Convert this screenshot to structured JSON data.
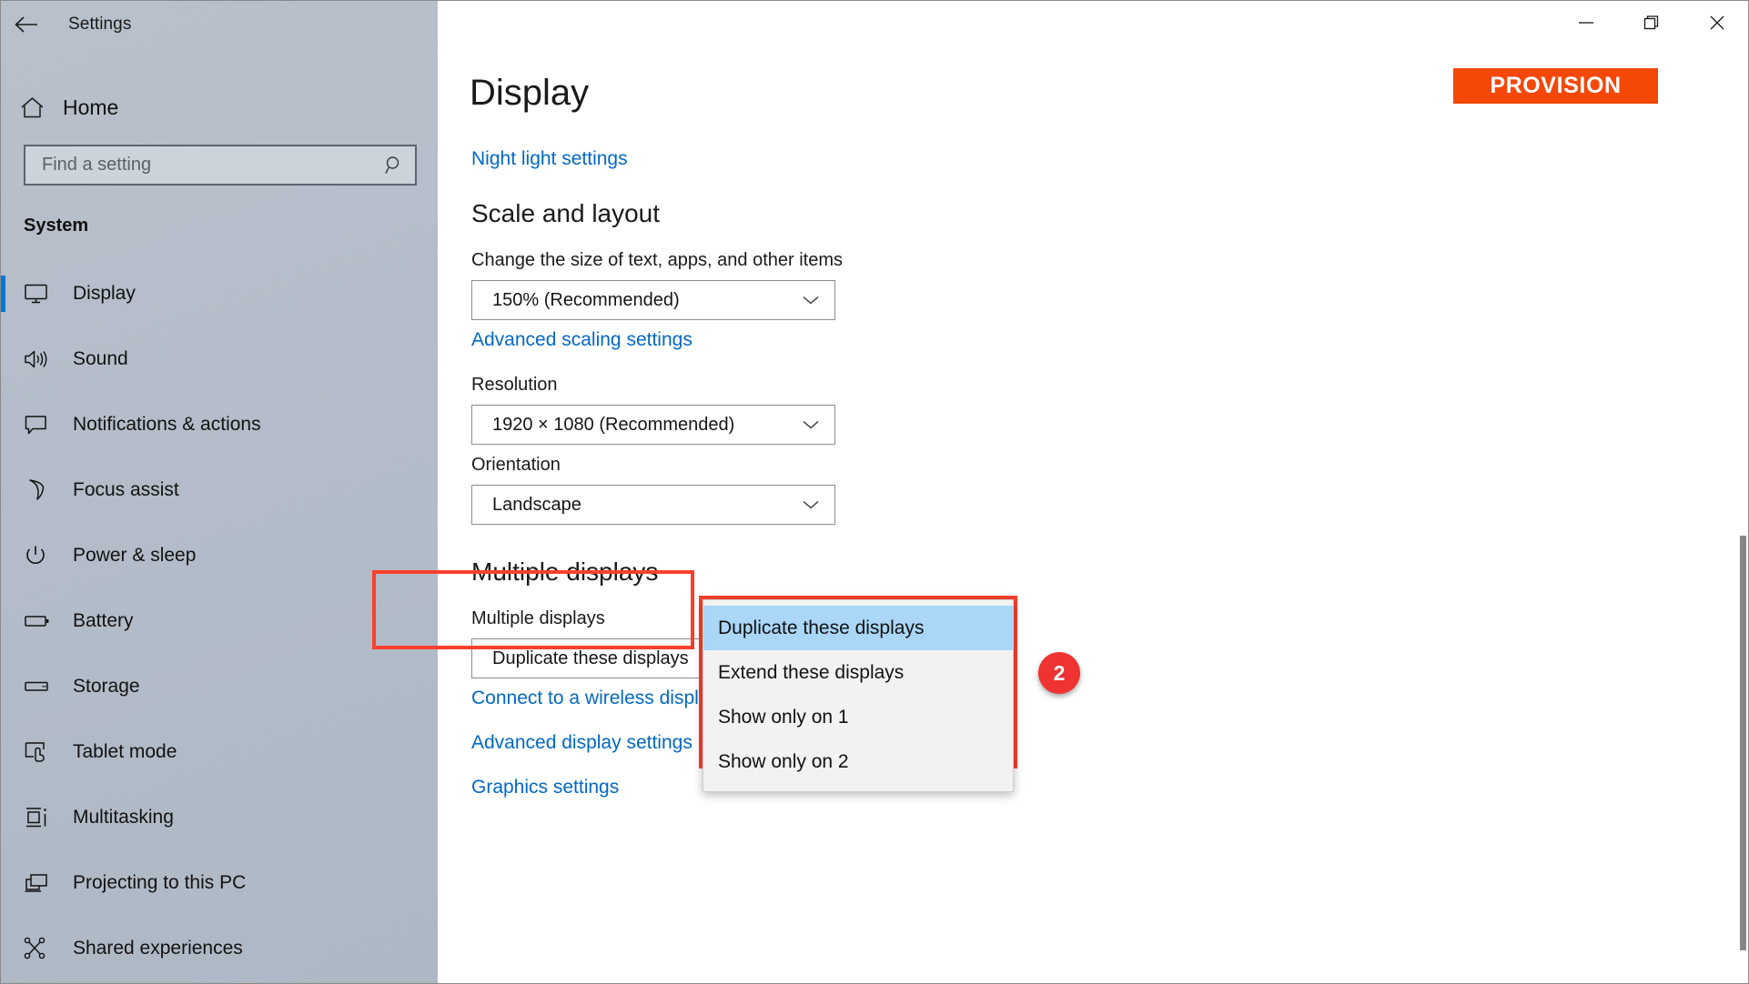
{
  "window": {
    "app_title": "Settings",
    "back_icon": "back-arrow-icon",
    "minimize_label": "—",
    "maximize_label": "❐",
    "close_label": "✕"
  },
  "sidebar": {
    "home_label": "Home",
    "home_icon": "home-icon",
    "search": {
      "placeholder": "Find a setting",
      "value": "",
      "icon": "search-icon"
    },
    "section_title": "System",
    "items": [
      {
        "label": "Display",
        "icon": "monitor-icon",
        "selected": true
      },
      {
        "label": "Sound",
        "icon": "speaker-icon",
        "selected": false
      },
      {
        "label": "Notifications & actions",
        "icon": "chat-bubble-icon",
        "selected": false
      },
      {
        "label": "Focus assist",
        "icon": "moon-icon",
        "selected": false
      },
      {
        "label": "Power & sleep",
        "icon": "power-icon",
        "selected": false
      },
      {
        "label": "Battery",
        "icon": "battery-icon",
        "selected": false
      },
      {
        "label": "Storage",
        "icon": "drive-icon",
        "selected": false
      },
      {
        "label": "Tablet mode",
        "icon": "tablet-touch-icon",
        "selected": false
      },
      {
        "label": "Multitasking",
        "icon": "multitasking-icon",
        "selected": false
      },
      {
        "label": "Projecting to this PC",
        "icon": "projecting-icon",
        "selected": false
      },
      {
        "label": "Shared experiences",
        "icon": "share-nodes-icon",
        "selected": false
      }
    ]
  },
  "brand": {
    "name": "PROVISION",
    "background_color": "#f44708",
    "text_color": "#ffffff"
  },
  "main": {
    "page_title": "Display",
    "night_light_link": "Night light settings",
    "scale_section": {
      "heading": "Scale and layout",
      "scale_label": "Change the size of text, apps, and other items",
      "scale_value": "150% (Recommended)",
      "advanced_scaling_link": "Advanced scaling settings",
      "resolution_label": "Resolution",
      "resolution_value": "1920 × 1080 (Recommended)",
      "orientation_label": "Orientation",
      "orientation_value": "Landscape"
    },
    "multiple_displays_section": {
      "heading": "Multiple displays",
      "field_label": "Multiple displays",
      "selected_value": "Duplicate these displays",
      "options": [
        {
          "label": "Duplicate these displays",
          "highlighted": true
        },
        {
          "label": "Extend these displays",
          "highlighted": false
        },
        {
          "label": "Show only on 1",
          "highlighted": false
        },
        {
          "label": "Show only on 2",
          "highlighted": false
        }
      ],
      "links": [
        "Connect to a wireless display",
        "Advanced display settings",
        "Graphics settings"
      ]
    }
  },
  "annotations": {
    "step_badge": "2",
    "badge_color": "#ef3232",
    "highlight_color": "#f9402c"
  }
}
